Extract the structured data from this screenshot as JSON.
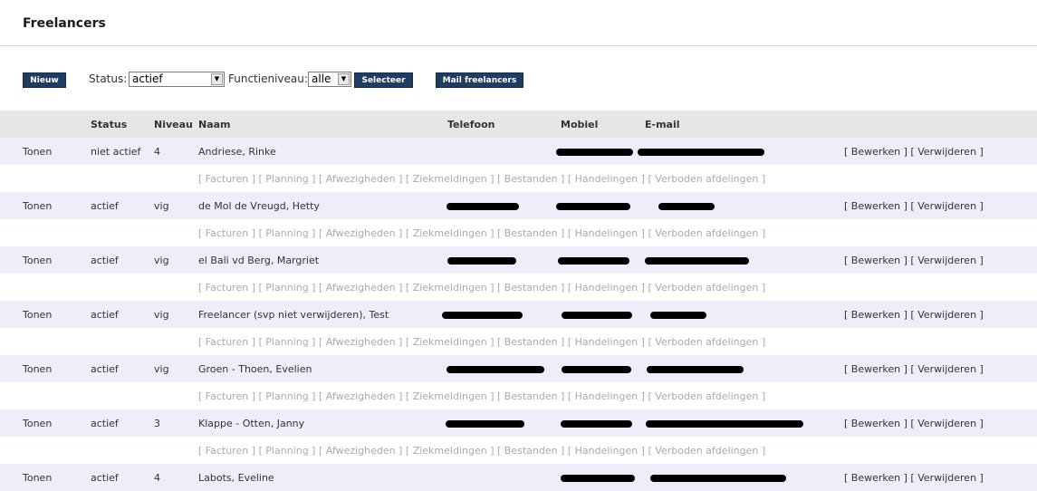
{
  "page": {
    "title": "Freelancers"
  },
  "toolbar": {
    "new_label": "Nieuw",
    "status_label": "Status:",
    "status_value": "actief",
    "functie_label": "Functieniveau:",
    "functie_value": "alle",
    "select_label": "Selecteer",
    "mail_label": "Mail freelancers"
  },
  "columns": [
    "",
    "Status",
    "Niveau",
    "Naam",
    "Telefoon",
    "Mobiel",
    "E-mail",
    ""
  ],
  "actions": {
    "toggle": "Tonen",
    "edit": "[ Bewerken ]",
    "delete": "[ Verwijderen ]"
  },
  "sublinks": [
    "[ Facturen ]",
    "[ Planning ]",
    "[ Afwezigheden ]",
    "[ Ziekmeldingen ]",
    "[ Bestanden ]",
    "[ Handelingen ]",
    "[ Verboden afdelingen ]"
  ],
  "rows": [
    {
      "status": "niet actief",
      "niveau": "4",
      "naam": "Andriese, Rinke"
    },
    {
      "status": "actief",
      "niveau": "vig",
      "naam": "de Mol de Vreugd, Hetty"
    },
    {
      "status": "actief",
      "niveau": "vig",
      "naam": "el Bali vd Berg, Margriet"
    },
    {
      "status": "actief",
      "niveau": "vig",
      "naam": "Freelancer (svp niet verwijderen), Test"
    },
    {
      "status": "actief",
      "niveau": "vig",
      "naam": "Groen - Thoen, Evelien"
    },
    {
      "status": "actief",
      "niveau": "3",
      "naam": "Klappe - Otten, Janny"
    },
    {
      "status": "actief",
      "niveau": "4",
      "naam": "Labots, Eveline"
    }
  ],
  "colors": {
    "button": "#1f3d63",
    "header_bg": "#e6e6e6",
    "row_bg": "#eeeefa",
    "muted": "#aaaaaa"
  }
}
